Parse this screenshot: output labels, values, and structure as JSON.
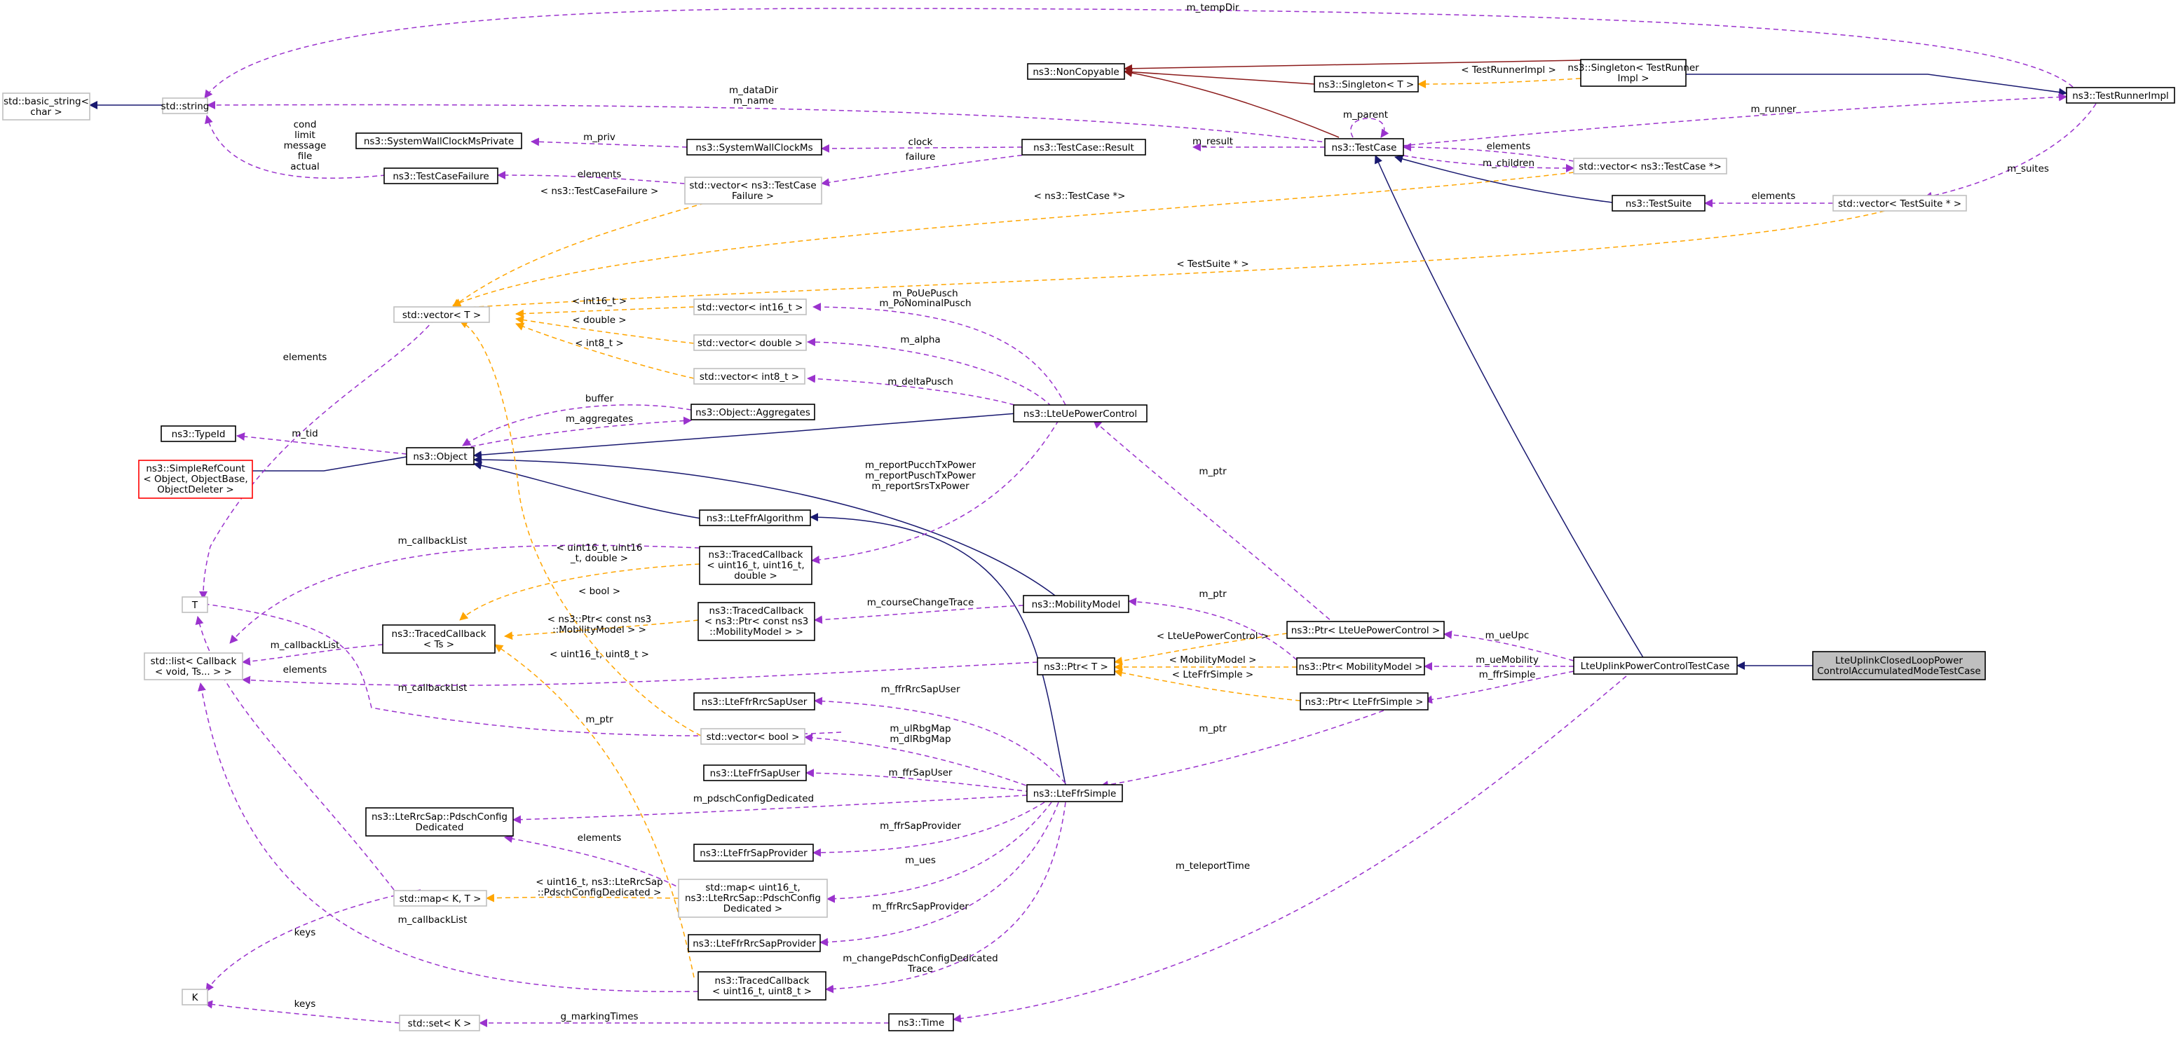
{
  "colors": {
    "inheritance": "#191970",
    "usage": "#9a32cd",
    "template": "#ffa500",
    "private_inheritance": "#8b1a1a",
    "node_border": "#000000",
    "external_border": "#bfbfbf",
    "missing_border": "#ff0000",
    "root_fill": "#bfbfbf"
  },
  "nodes": {
    "basic_string": [
      "std::basic_string<",
      "char >"
    ],
    "std_string": [
      "std::string"
    ],
    "noncopyable": [
      "ns3::NonCopyable"
    ],
    "singleton_t": [
      "ns3::Singleton< T >"
    ],
    "singleton_tr": [
      "ns3::Singleton< TestRunner",
      "Impl >"
    ],
    "testrunnerimpl": [
      "ns3::TestRunnerImpl"
    ],
    "swcms_private": [
      "ns3::SystemWallClockMsPrivate"
    ],
    "swcms": [
      "ns3::SystemWallClockMs"
    ],
    "tcresult": [
      "ns3::TestCase::Result"
    ],
    "testcase": [
      "ns3::TestCase"
    ],
    "testcasefailure": [
      "ns3::TestCaseFailure"
    ],
    "vec_tcfailure": [
      "std::vector< ns3::TestCase",
      "Failure >"
    ],
    "vec_tcptr": [
      "std::vector< ns3::TestCase *>"
    ],
    "testsuite": [
      "ns3::TestSuite"
    ],
    "vec_tsptr": [
      "std::vector< TestSuite * >"
    ],
    "vec_t": [
      "std::vector< T >"
    ],
    "vec_int16": [
      "std::vector< int16_t >"
    ],
    "vec_double": [
      "std::vector< double >"
    ],
    "vec_int8": [
      "std::vector< int8_t >"
    ],
    "aggregates": [
      "ns3::Object::Aggregates"
    ],
    "typeid": [
      "ns3::TypeId"
    ],
    "object": [
      "ns3::Object"
    ],
    "simplerefcount": [
      "ns3::SimpleRefCount",
      "< Object, ObjectBase,",
      "ObjectDeleter >"
    ],
    "ltepc": [
      "ns3::LteUePowerControl"
    ],
    "lteffralgo": [
      "ns3::LteFfrAlgorithm"
    ],
    "tc_u16u16d": [
      "ns3::TracedCallback",
      "< uint16_t, uint16_t,",
      "double >"
    ],
    "t_node": [
      "T"
    ],
    "list_cb": [
      "std::list< Callback",
      "< void, Ts... > >"
    ],
    "tc_ts": [
      "ns3::TracedCallback",
      "< Ts >"
    ],
    "tc_mob": [
      "ns3::TracedCallback",
      "< ns3::Ptr< const ns3",
      "::MobilityModel > >"
    ],
    "mobility": [
      "ns3::MobilityModel"
    ],
    "ptr_t": [
      "ns3::Ptr< T >"
    ],
    "ptr_ltepc": [
      "ns3::Ptr< LteUePowerControl >"
    ],
    "ptr_mob": [
      "ns3::Ptr< MobilityModel >"
    ],
    "ptr_ffr": [
      "ns3::Ptr< LteFfrSimple >"
    ],
    "lteuplink": [
      "LteUplinkPowerControlTestCase"
    ],
    "root": [
      "LteUplinkClosedLoopPower",
      "ControlAccumulatedModeTestCase"
    ],
    "ffr_rrcsapuser": [
      "ns3::LteFfrRrcSapUser"
    ],
    "vec_bool": [
      "std::vector< bool >"
    ],
    "ffr_sapuser": [
      "ns3::LteFfrSapUser"
    ],
    "pdsch": [
      "ns3::LteRrcSap::PdschConfig",
      "Dedicated"
    ],
    "lteffrsimple": [
      "ns3::LteFfrSimple"
    ],
    "ffr_sapprovider": [
      "ns3::LteFfrSapProvider"
    ],
    "map_kt": [
      "std::map< K, T >"
    ],
    "map_u16": [
      "std::map< uint16_t,",
      "ns3::LteRrcSap::PdschConfig",
      "Dedicated >"
    ],
    "ffr_rrcsapprovider": [
      "ns3::LteFfrRrcSapProvider"
    ],
    "k_node": [
      "K"
    ],
    "tc_u16u8": [
      "ns3::TracedCallback",
      "< uint16_t, uint8_t >"
    ],
    "set_k": [
      "std::set< K >"
    ],
    "time": [
      "ns3::Time"
    ]
  },
  "edge_labels": {
    "m_tempDir": [
      "m_tempDir"
    ],
    "m_dataDir": [
      "m_dataDir",
      "m_name"
    ],
    "testrunnerimpl_tmpl": [
      "< TestRunnerImpl >"
    ],
    "m_parent": [
      "m_parent"
    ],
    "m_runner": [
      "m_runner"
    ],
    "m_suites": [
      "m_suites"
    ],
    "cond": [
      "cond",
      "limit",
      "message",
      "file",
      "actual"
    ],
    "m_priv": [
      "m_priv"
    ],
    "clock": [
      "clock"
    ],
    "failure": [
      "failure"
    ],
    "m_result": [
      "m_result"
    ],
    "elements_tcptr": [
      "elements"
    ],
    "m_children": [
      "m_children"
    ],
    "elements_tcf": [
      "elements"
    ],
    "tcfailure_tmpl": [
      "< ns3::TestCaseFailure >"
    ],
    "elements_ts": [
      "elements"
    ],
    "testcaseptr_tmpl": [
      "< ns3::TestCase *>"
    ],
    "testsuite_tmpl": [
      "< TestSuite * >"
    ],
    "int16_tmpl": [
      "< int16_t >"
    ],
    "double_tmpl": [
      "< double >"
    ],
    "int8_tmpl": [
      "< int8_t >"
    ],
    "m_PoUePusch": [
      "m_PoUePusch",
      "m_PoNominalPusch"
    ],
    "m_alpha": [
      "m_alpha"
    ],
    "m_deltaPusch": [
      "m_deltaPusch"
    ],
    "elements_vt": [
      "elements"
    ],
    "buffer": [
      "buffer"
    ],
    "m_aggregates": [
      "m_aggregates"
    ],
    "m_tid": [
      "m_tid"
    ],
    "m_ptr_ltepc": [
      "m_ptr"
    ],
    "m_reportPucch": [
      "m_reportPucchTxPower",
      "m_reportPuschTxPower",
      "m_reportSrsTxPower"
    ],
    "m_callbackList_1": [
      "m_callbackList"
    ],
    "u16u16d_tmpl": [
      "< uint16_t, uint16",
      "_t, double >"
    ],
    "bool_tmpl": [
      "< bool >"
    ],
    "m_courseChangeTrace": [
      "m_courseChangeTrace"
    ],
    "m_ptr_mob": [
      "m_ptr"
    ],
    "mob_tmpl": [
      "< ns3::Ptr< const ns3",
      "::MobilityModel > >"
    ],
    "m_callbackList_2": [
      "m_callbackList"
    ],
    "elements_list": [
      "elements"
    ],
    "u16u8_tmpl": [
      "< uint16_t, uint8_t >"
    ],
    "m_ueUpc": [
      "m_ueUpc"
    ],
    "ltepc_tmpl": [
      "< LteUePowerControl >"
    ],
    "mobmodel_tmpl": [
      "< MobilityModel >"
    ],
    "ffrsimple_tmpl": [
      "< LteFfrSimple >"
    ],
    "m_ueMobility": [
      "m_ueMobility"
    ],
    "m_ffrSimple": [
      "m_ffrSimple"
    ],
    "m_callbackList_3": [
      "m_callbackList"
    ],
    "m_ffrRrcSapUser": [
      "m_ffrRrcSapUser"
    ],
    "m_ptr_t": [
      "m_ptr"
    ],
    "m_ulRbgMap": [
      "m_ulRbgMap",
      "m_dlRbgMap"
    ],
    "m_ptr_ffr": [
      "m_ptr"
    ],
    "m_ffrSapUser": [
      "m_ffrSapUser"
    ],
    "m_pdschConfigDedicated": [
      "m_pdschConfigDedicated"
    ],
    "m_ffrSapProvider": [
      "m_ffrSapProvider"
    ],
    "elements_map": [
      "elements"
    ],
    "map_tmpl": [
      "< uint16_t, ns3::LteRrcSap",
      "::PdschConfigDedicated >"
    ],
    "m_ues": [
      "m_ues"
    ],
    "m_teleportTime": [
      "m_teleportTime"
    ],
    "m_ffrRrcSapProvider": [
      "m_ffrRrcSapProvider"
    ],
    "m_callbackList_4": [
      "m_callbackList"
    ],
    "keys_1": [
      "keys"
    ],
    "m_changePdsch": [
      "m_changePdschConfigDedicated",
      "Trace"
    ],
    "keys_2": [
      "keys"
    ],
    "g_markingTimes": [
      "g_markingTimes"
    ]
  }
}
